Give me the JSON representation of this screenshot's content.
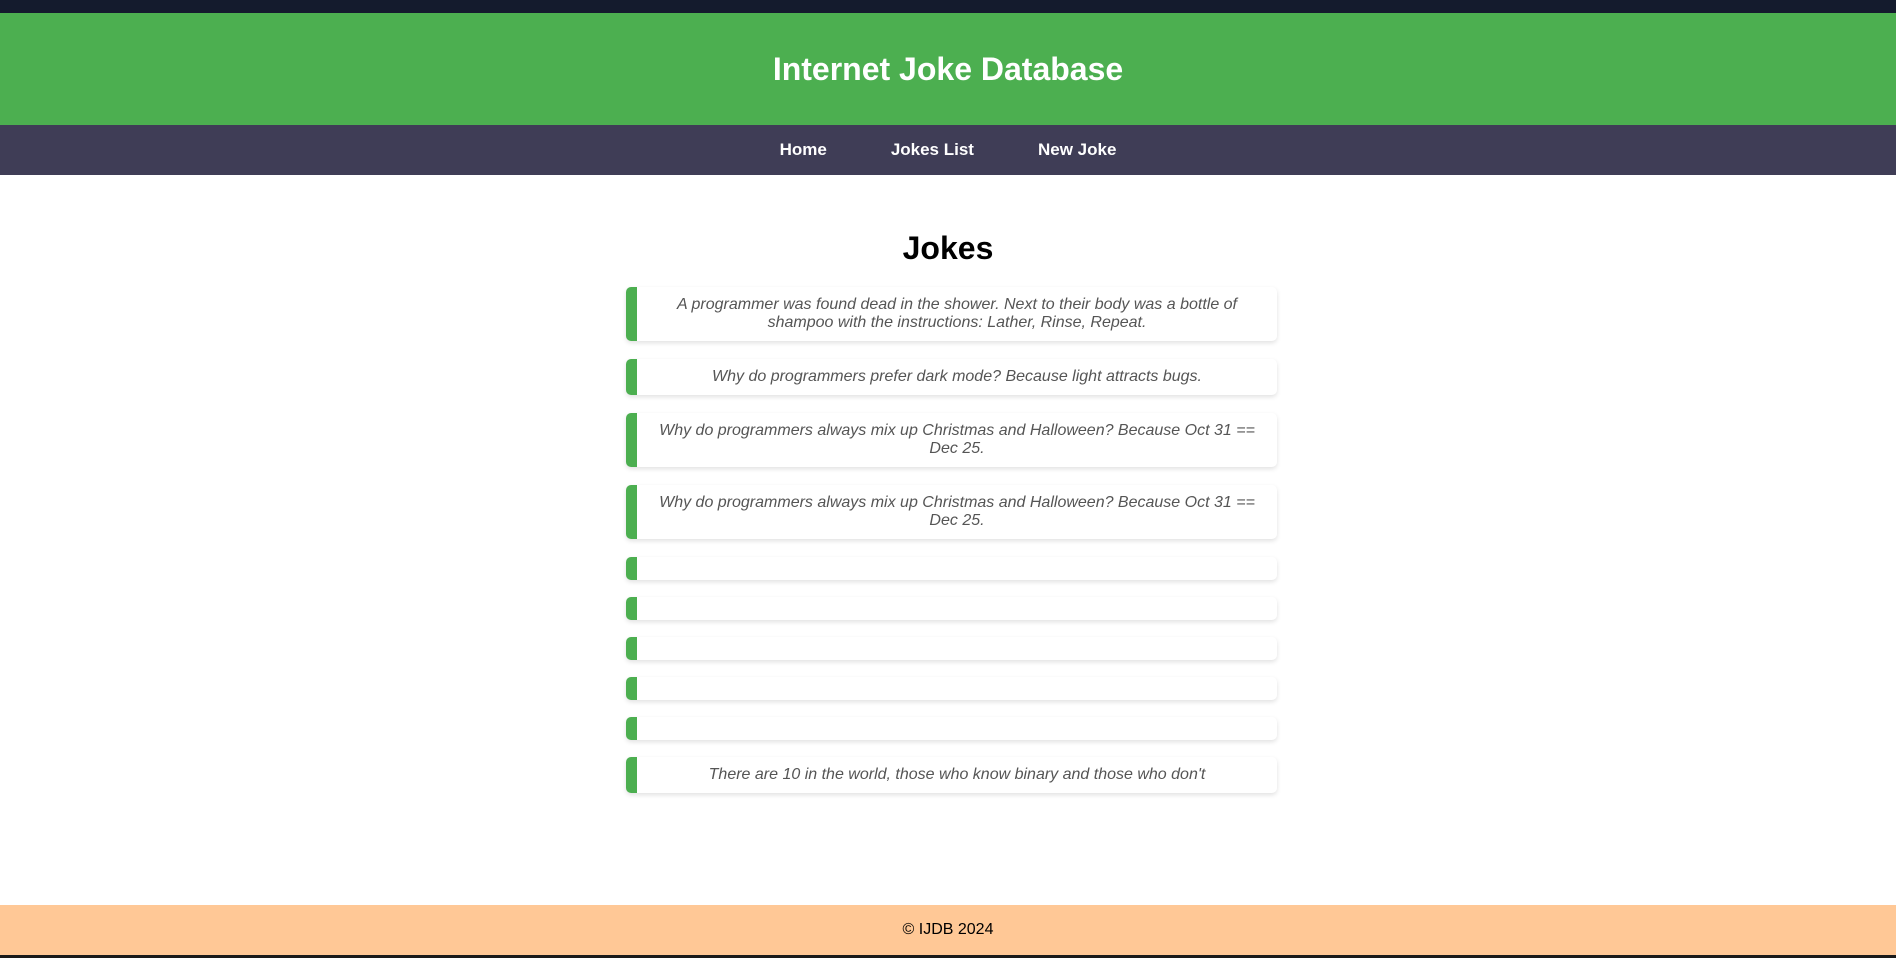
{
  "header": {
    "title": "Internet Joke Database"
  },
  "nav": {
    "items": [
      {
        "label": "Home"
      },
      {
        "label": "Jokes List"
      },
      {
        "label": "New Joke"
      }
    ]
  },
  "main": {
    "title": "Jokes",
    "jokes": [
      {
        "text": "A programmer was found dead in the shower. Next to their body was a bottle of shampoo with the instructions: Lather, Rinse, Repeat."
      },
      {
        "text": "Why do programmers prefer dark mode? Because light attracts bugs."
      },
      {
        "text": "Why do programmers always mix up Christmas and Halloween? Because Oct 31 == Dec 25."
      },
      {
        "text": "Why do programmers always mix up Christmas and Halloween? Because Oct 31 == Dec 25."
      },
      {
        "text": ""
      },
      {
        "text": ""
      },
      {
        "text": ""
      },
      {
        "text": ""
      },
      {
        "text": ""
      },
      {
        "text": "There are 10 in the world, those who know binary and those who don't"
      }
    ]
  },
  "footer": {
    "text": "© IJDB 2024"
  },
  "colors": {
    "header_bg": "#4caf50",
    "nav_bg": "#3f3d56",
    "accent": "#4caf50",
    "footer_bg": "#ffc896"
  }
}
